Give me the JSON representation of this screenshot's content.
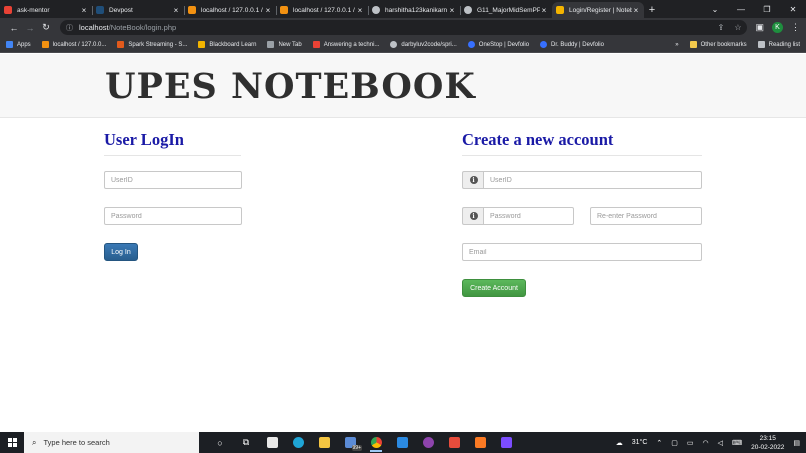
{
  "browser": {
    "tabs": [
      {
        "label": "ask-mentor",
        "color": "#e94235",
        "active": false
      },
      {
        "label": "Devpost",
        "color": "#1f4e79",
        "active": false
      },
      {
        "label": "localhost / 127.0.0.1 /",
        "color": "#f29111",
        "active": false
      },
      {
        "label": "localhost / 127.0.0.1 /",
        "color": "#f29111",
        "active": false
      },
      {
        "label": "harshitha123kanikarn",
        "color": "#bdc1c6",
        "active": false
      },
      {
        "label": "G11_MajorMidSemPPT",
        "color": "#bdc1c6",
        "active": false
      },
      {
        "label": "Login/Register | Notebook",
        "color": "#f4b400",
        "active": true
      }
    ],
    "new_tab": "+",
    "url_host": "localhost",
    "url_path": "/NoteBook/login.php",
    "profile_initial": "K",
    "bookmarks": [
      {
        "label": "Apps",
        "color": "#4285f4"
      },
      {
        "label": "localhost / 127.0.0...",
        "color": "#f29111"
      },
      {
        "label": "Spark Streaming - S...",
        "color": "#e25a1c"
      },
      {
        "label": "Blackboard Learn",
        "color": "#f2b400"
      },
      {
        "label": "New Tab",
        "color": "#9aa0a6"
      },
      {
        "label": "Answering a techni...",
        "color": "#e94235"
      },
      {
        "label": "darbyluv2code/spri...",
        "color": "#bdc1c6"
      },
      {
        "label": "OneStop | Devfolio",
        "color": "#3770ff"
      },
      {
        "label": "Dr. Buddy | Devfolio",
        "color": "#3770ff"
      }
    ],
    "bookmarks_more": "»",
    "other_bookmarks": "Other bookmarks",
    "reading_list": "Reading list"
  },
  "page": {
    "brand": "UPES NOTEBOOK",
    "login": {
      "title": "User LogIn",
      "userid_placeholder": "UserID",
      "password_placeholder": "Password",
      "submit_label": "Log In"
    },
    "register": {
      "title": "Create a new account",
      "userid_placeholder": "UserID",
      "password_placeholder": "Password",
      "reenter_placeholder": "Re-enter Password",
      "email_placeholder": "Email",
      "submit_label": "Create Account"
    }
  },
  "taskbar": {
    "search_placeholder": "Type here to search",
    "badge": "99+",
    "temperature": "31°C",
    "time": "23:15",
    "date": "20-02-2022"
  }
}
